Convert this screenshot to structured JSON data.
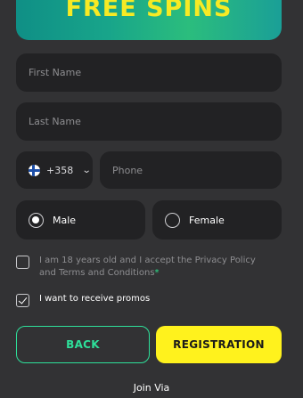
{
  "banner": {
    "title": "FREE SPINS"
  },
  "form": {
    "first_name_placeholder": "First Name",
    "last_name_placeholder": "Last Name",
    "phone_code": "+358",
    "phone_placeholder": "Phone",
    "gender": {
      "male": "Male",
      "female": "Female",
      "selected": "Male"
    },
    "terms_text": "I am 18 years old and I accept the Privacy Policy and Terms and Conditions",
    "terms_required_mark": "*",
    "terms_checked": false,
    "promo_text": "I want to receive promos",
    "promo_checked": true
  },
  "actions": {
    "back_label": "BACK",
    "registration_label": "REGISTRATION"
  },
  "footer": {
    "join_via": "Join Via"
  },
  "colors": {
    "background": "#323234",
    "field": "#222224",
    "accent_green": "#2ee09a",
    "accent_yellow": "#fff21d"
  }
}
